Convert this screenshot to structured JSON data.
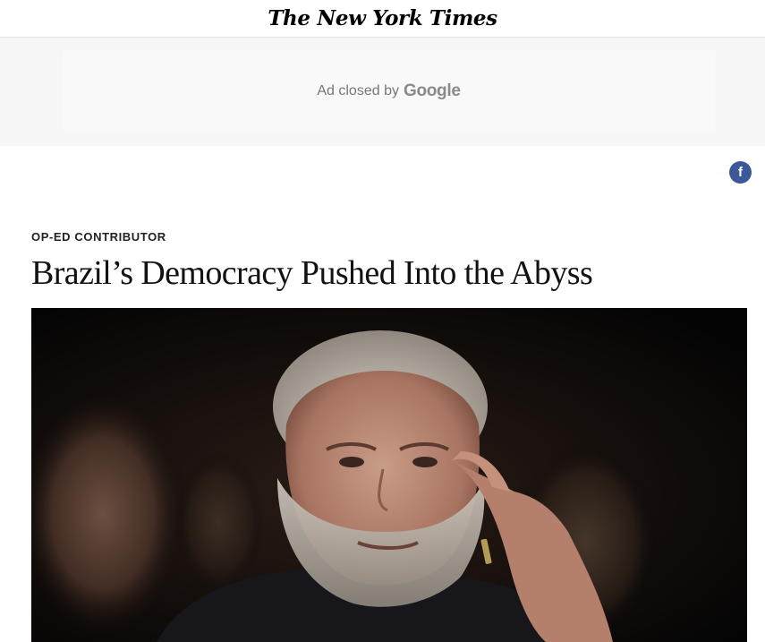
{
  "masthead": {
    "logo_text": "The New York Times"
  },
  "ad": {
    "closed_text": "Ad closed by",
    "brand": "Google"
  },
  "share": {
    "facebook_glyph": "f",
    "facebook_icon": "facebook-icon",
    "facebook_color": "#3b5998"
  },
  "article": {
    "kicker": "OP-ED CONTRIBUTOR",
    "headline": "Brazil’s Democracy Pushed Into the Abyss"
  },
  "hero_image": {
    "subject": "photo-placeholder"
  }
}
